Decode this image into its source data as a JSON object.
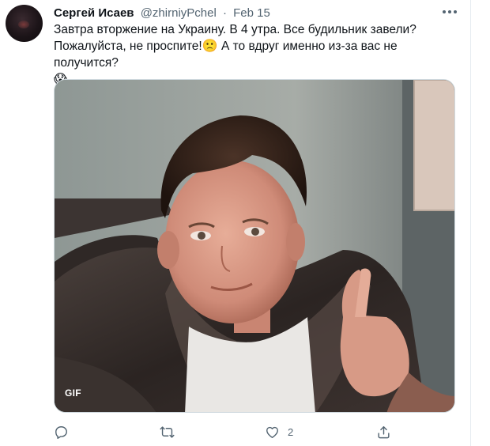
{
  "tweet": {
    "author_name": "Сергей Исаев",
    "handle": "@zhirniyPchel",
    "separator": "·",
    "date": "Feb 15",
    "text_line1": "Завтра вторжение на Украину. В 4 утра. Все будильник завели?",
    "text_line2_a": "Пожалуйста, не проспите!",
    "text_line2_b": " А то вдруг именно из-за вас не получится?",
    "emoji_1": "🙁",
    "emoji_2": "😱",
    "media_badge": "GIF",
    "likes_count": "2"
  },
  "icons": {
    "avatar": "avatar",
    "more": "more-horizontal-icon",
    "reply": "reply-icon",
    "retweet": "retweet-icon",
    "like": "heart-icon",
    "share": "share-icon"
  },
  "colors": {
    "text_primary": "#0f1419",
    "text_secondary": "#536471",
    "border": "#cfd9de"
  }
}
